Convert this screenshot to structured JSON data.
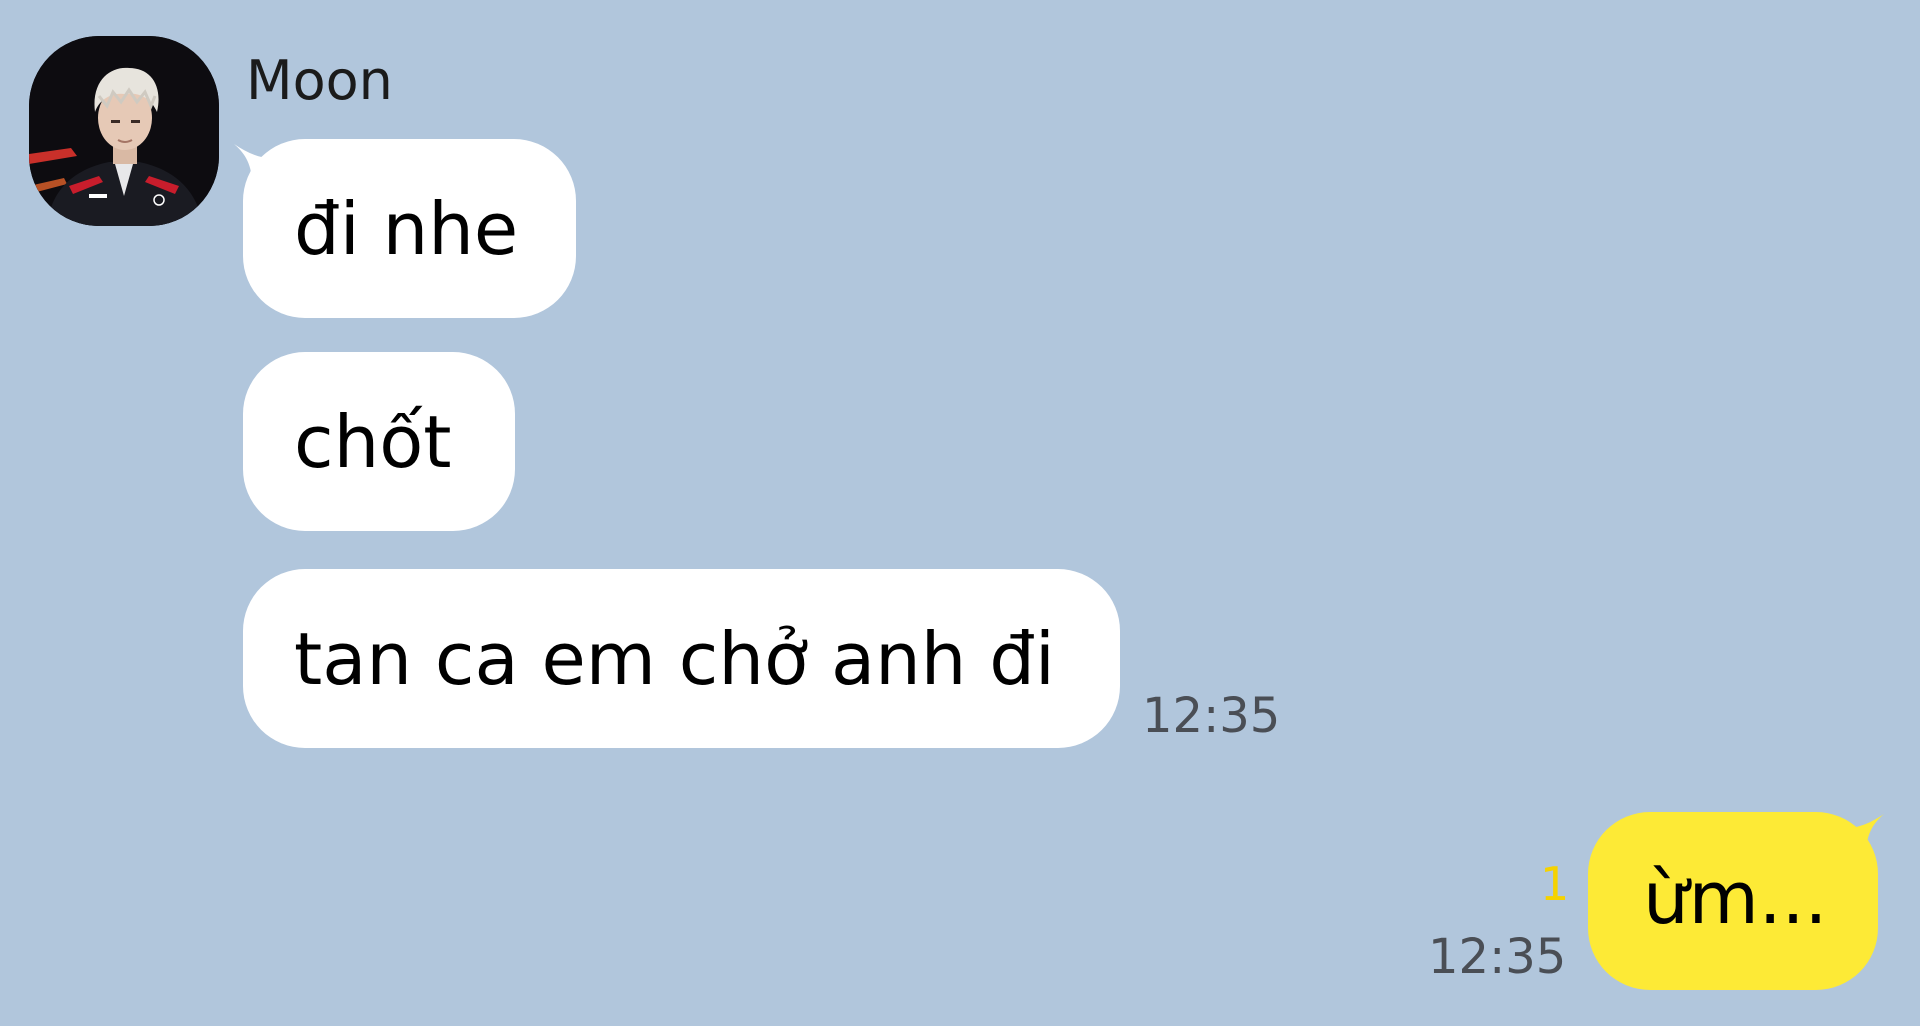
{
  "chat": {
    "background_color": "#b1c6dc",
    "incoming": {
      "sender_name": "Moon",
      "avatar_icon": "user-photo-avatar",
      "messages": [
        {
          "text": "đi nhe"
        },
        {
          "text": "chốt"
        },
        {
          "text": "tan ca em chở anh đi"
        }
      ],
      "timestamp": "12:35",
      "bubble_color": "#ffffff"
    },
    "outgoing": {
      "messages": [
        {
          "text": "ừm..."
        }
      ],
      "unread_count": "1",
      "timestamp": "12:35",
      "bubble_color": "#fdea36",
      "unread_color": "#f5d200"
    }
  }
}
